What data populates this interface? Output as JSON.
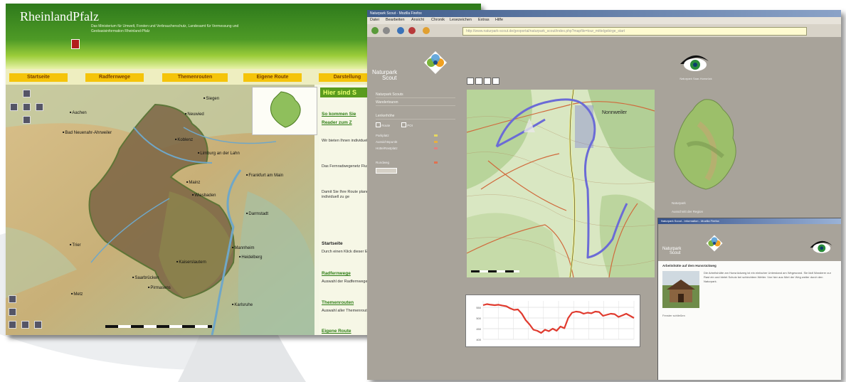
{
  "left_portal": {
    "brand": "RheinlandPfalz",
    "subtitle": "Das Ministerium für Umwelt, Forsten und Verbraucherschutz, Landesamt für Vermessung und Geobasisinformation Rheinland-Pfalz",
    "nav_tabs": [
      "Startseite",
      "Radfernwege",
      "Themenrouten",
      "Eigene Route",
      "Darstellung"
    ],
    "cities": [
      "Siegen",
      "Aachen",
      "Neuwied",
      "Limburg an der Lahn",
      "Bad Neuenahr-Ahrweiler",
      "Koblenz",
      "Frankfurt am Main",
      "Wiesbaden",
      "Darmstadt",
      "Trier",
      "Kaiserslautern",
      "Mannheim",
      "Heidelberg",
      "Saarbrücken",
      "Karlsruhe",
      "Metz",
      "Pirmasens",
      "Mainz"
    ],
    "sidebar": {
      "head": "Hier sind S",
      "link_top": "So kommen Sie",
      "link_top2": "Reader zum Z",
      "para1": "Wir bieten Ihnen individuelle Routen in Rheinland-Pfalz",
      "para2": "Das Fernradwegenetz Flussläufe und Täler ist bekannt und",
      "para3": "Damit Sie Ihre Route planen können Übersicht und die Radfernwege und Möglichkeit Ihre individuell zu ge",
      "heading_start": "Startseite",
      "para4": "Durch einen Klick dieser Einführung",
      "link_radfern": "Radfernwege",
      "para5": "Auswahl der Radfernwege Rheinland-Pfalz",
      "link_themen": "Themenrouten",
      "para6": "Auswahl aller Themenrouten",
      "link_eigene": "Eigene Route"
    }
  },
  "right_portal": {
    "browser_title": "Naturpark Scout - Mozilla Firefox",
    "menu": [
      "Datei",
      "Bearbeiten",
      "Ansicht",
      "Chronik",
      "Lesezeichen",
      "Extras",
      "Hilfe"
    ],
    "url": "http://www.naturpark-scout.de/geoportal/naturpark_scout/index.php?mapfile=tour_mittelgebirge_start",
    "logo_text_1": "Naturpark",
    "logo_text_2": "Scout",
    "eye_caption": "Naturpark Saar-Hunsrück",
    "menu_items": [
      "Naturpark Scouts",
      "Wandertouren",
      "Lenkerhöhe"
    ],
    "legend_toggle": [
      "Route",
      "POI"
    ],
    "legend": [
      {
        "label": "Parkplatz",
        "color": "#e6d860"
      },
      {
        "label": "Aussichtspunkt",
        "color": "#e6b040"
      },
      {
        "label": "Hütte/Rastplatz",
        "color": "#e08080"
      },
      {
        "label": "Rundweg",
        "color": "#e07050"
      }
    ],
    "map_town": "Nonnweiler",
    "elevation_profile": {
      "type": "line",
      "x": [
        0,
        1,
        2,
        3,
        4,
        5,
        6,
        7,
        8,
        9,
        10,
        11,
        12,
        13,
        14,
        15,
        16,
        17,
        18,
        19,
        20,
        21,
        22,
        23,
        24,
        25,
        26,
        27,
        28,
        29,
        30,
        31,
        32,
        33,
        34,
        35,
        36,
        37,
        38,
        39
      ],
      "y": [
        560,
        565,
        562,
        560,
        562,
        558,
        555,
        545,
        538,
        540,
        520,
        490,
        470,
        445,
        440,
        430,
        445,
        438,
        450,
        440,
        460,
        452,
        500,
        525,
        530,
        528,
        520,
        525,
        522,
        530,
        528,
        510,
        515,
        520,
        518,
        505,
        512,
        520,
        510,
        500
      ],
      "ylim": [
        400,
        580
      ],
      "y_ticks": [
        "400",
        "450",
        "500",
        "550"
      ]
    },
    "np_links": [
      "Naturpark",
      "Ausschnitt der Region"
    ],
    "popup": {
      "title": "Naturpark Scout - Information - Mozilla Firefox",
      "subtitle": "Arbeitshütte auf dem Hunsrückweg",
      "text": "Die Arbeitshütte am Hunsrückweg ist ein einfacher Unterstand am Wegesrand. Sie lädt Wanderer zur Rast ein und bietet Schutz bei schlechtem Wetter. Von hier aus führt der Weg weiter durch den Naturpark.",
      "footer": "Fenster schließen"
    }
  }
}
